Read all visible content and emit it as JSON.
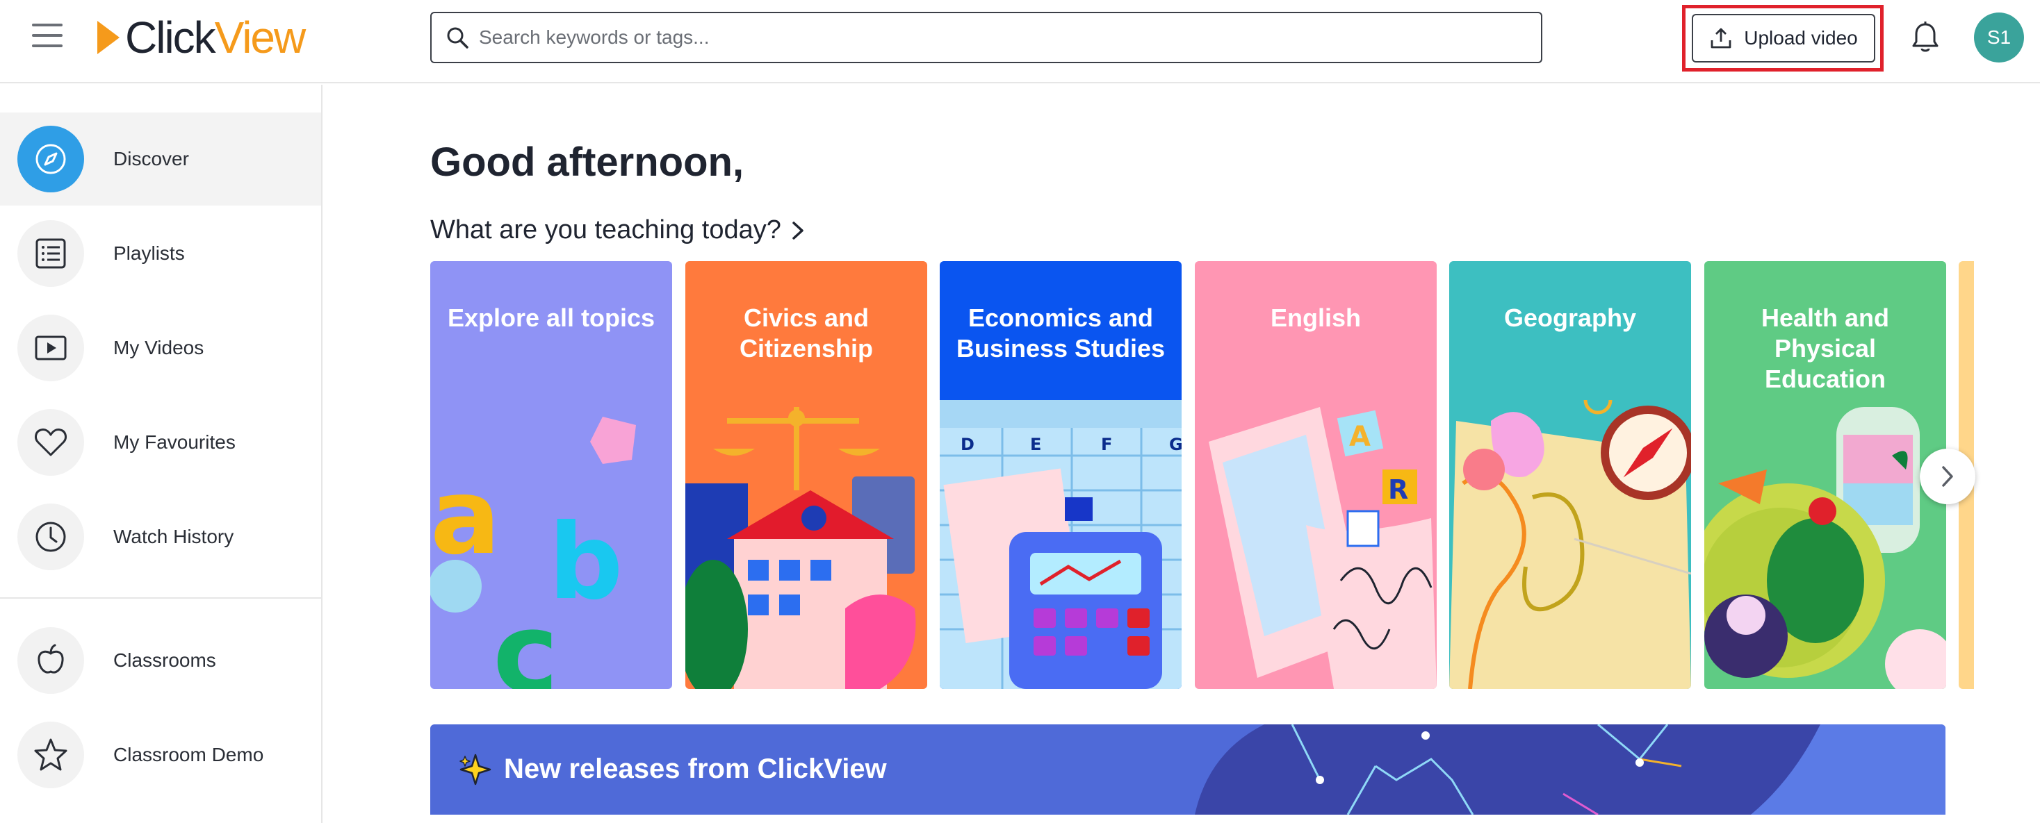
{
  "header": {
    "logo": {
      "part1": "Click",
      "part2": "View"
    },
    "search": {
      "placeholder": "Search keywords or tags..."
    },
    "upload_label": "Upload video",
    "avatar_initials": "S1"
  },
  "sidebar": {
    "items": [
      {
        "label": "Discover",
        "icon": "compass-icon",
        "active": true
      },
      {
        "label": "Playlists",
        "icon": "list-icon"
      },
      {
        "label": "My Videos",
        "icon": "play-icon"
      },
      {
        "label": "My Favourites",
        "icon": "heart-icon"
      },
      {
        "label": "Watch History",
        "icon": "clock-icon"
      },
      {
        "label": "Classrooms",
        "icon": "apple-icon"
      },
      {
        "label": "Classroom Demo",
        "icon": "star-icon"
      }
    ]
  },
  "main": {
    "greeting": "Good afternoon,",
    "subheading": "What are you teaching today?",
    "topics": [
      {
        "title": "Explore all topics",
        "color": "#8f93f5"
      },
      {
        "title": "Civics and Citizenship",
        "color": "#ff7a3d"
      },
      {
        "title": "Economics and Business Studies",
        "color": "#0a55f0"
      },
      {
        "title": "English",
        "color": "#ff96b3"
      },
      {
        "title": "Geography",
        "color": "#3dbfc1"
      },
      {
        "title": "Health and Physical Education",
        "color": "#5fcb84"
      }
    ],
    "banner_title": "New releases from ClickView"
  },
  "colors": {
    "brand_orange": "#f59a1b",
    "accent_blue": "#2f9ee6",
    "avatar": "#3aa39b",
    "highlight_red": "#e0212b",
    "banner": "#4f6ad8"
  }
}
